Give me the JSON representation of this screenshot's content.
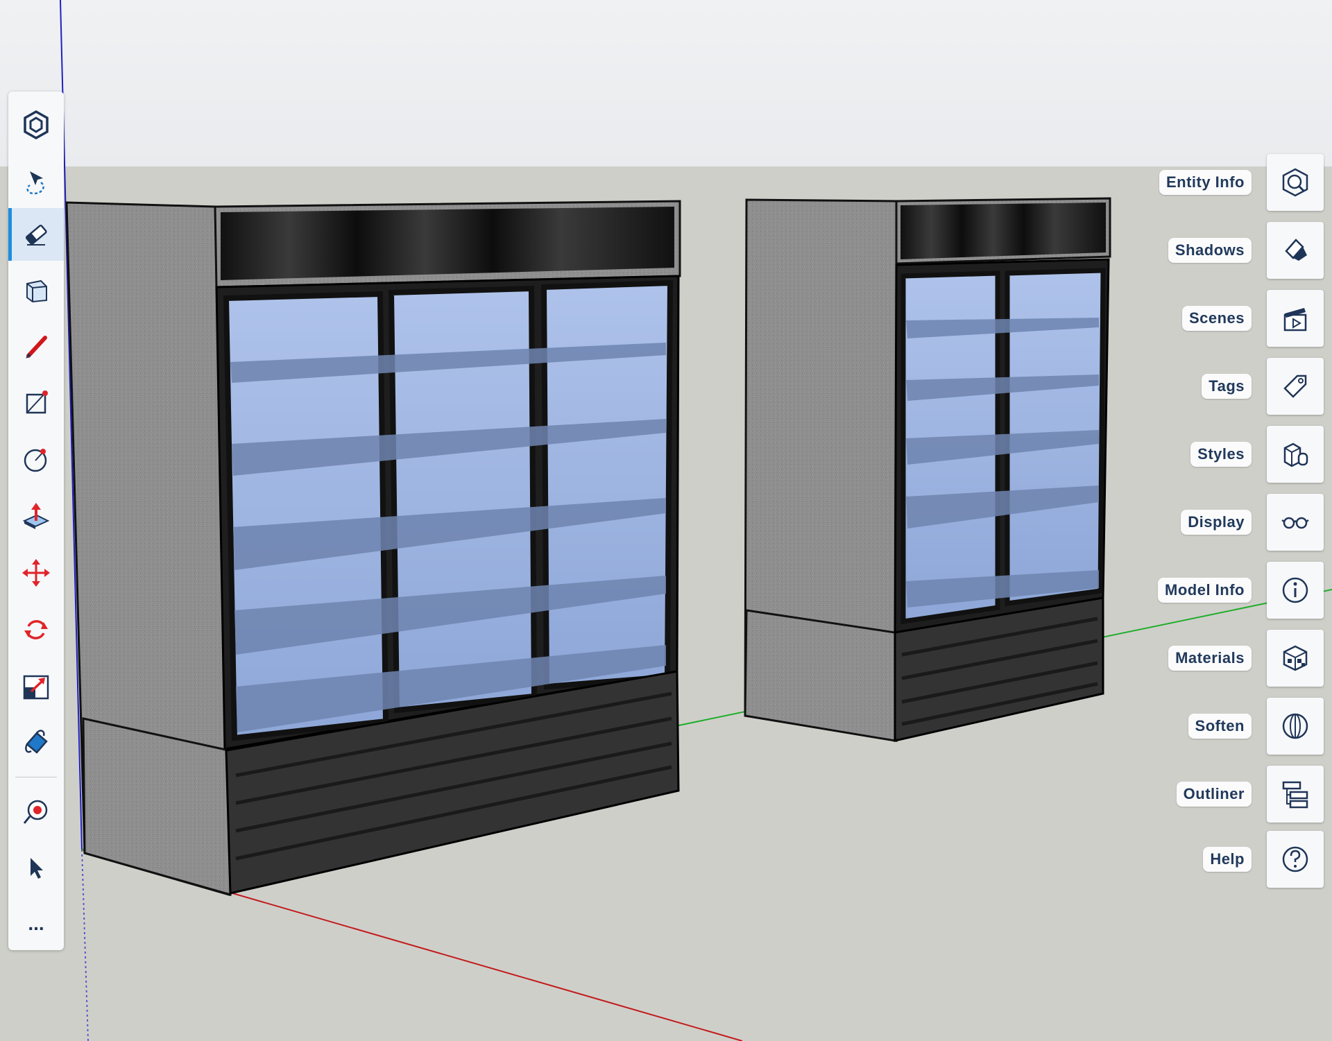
{
  "toolbar": {
    "tools": [
      {
        "icon": "sketchup-logo-icon"
      },
      {
        "icon": "lasso-select-icon"
      },
      {
        "icon": "eraser-icon",
        "active": true
      },
      {
        "icon": "push-pull-box-icon"
      },
      {
        "icon": "pencil-icon"
      },
      {
        "icon": "rectangle-line-icon"
      },
      {
        "icon": "circle-icon"
      },
      {
        "icon": "push-pull-icon"
      },
      {
        "icon": "move-icon"
      },
      {
        "icon": "rotate-icon"
      },
      {
        "icon": "scale-icon"
      },
      {
        "icon": "paint-bucket-icon"
      },
      {
        "icon": "tape-measure-icon"
      },
      {
        "icon": "select-arrow-icon"
      },
      {
        "icon": "more-icon",
        "label": "..."
      }
    ]
  },
  "panels": [
    {
      "label": "Entity Info",
      "icon": "entity-info-icon"
    },
    {
      "label": "Shadows",
      "icon": "shadows-icon"
    },
    {
      "label": "Scenes",
      "icon": "scenes-icon"
    },
    {
      "label": "Tags",
      "icon": "tags-icon"
    },
    {
      "label": "Styles",
      "icon": "styles-icon"
    },
    {
      "label": "Display",
      "icon": "display-icon"
    },
    {
      "label": "Model Info",
      "icon": "model-info-icon"
    },
    {
      "label": "Materials",
      "icon": "materials-icon"
    },
    {
      "label": "Soften",
      "icon": "soften-icon"
    },
    {
      "label": "Outliner",
      "icon": "outliner-icon"
    },
    {
      "label": "Help",
      "icon": "help-icon"
    }
  ],
  "colors": {
    "accent": "#1d8ee0",
    "active_tool_bg": "#dbe7f4",
    "label_text": "#213a5c",
    "icon_dark": "#1f3557",
    "axis_red": "#c21b1b",
    "axis_green": "#1fae2a",
    "axis_blue": "#2020c0",
    "cabinet_gray": "#8f8f8f",
    "glass_blue": "#a8bde6"
  }
}
